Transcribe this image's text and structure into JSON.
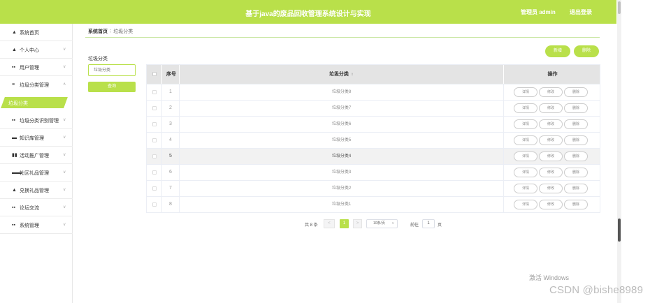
{
  "header": {
    "title": "基于java的废品回收管理系统设计与实现",
    "admin": "管理员 admin",
    "logout": "退出登录"
  },
  "sidebar": {
    "items": [
      {
        "icon": "▲",
        "label": "系统首页",
        "chevron": ""
      },
      {
        "icon": "▲",
        "label": "个人中心",
        "chevron": "∨"
      },
      {
        "icon": "▪▪",
        "label": "用户管理",
        "chevron": "∨"
      },
      {
        "icon": "≡",
        "label": "垃圾分类管理",
        "chevron": "∧"
      },
      {
        "icon": "▪▪",
        "label": "垃圾分类识别管理",
        "chevron": "∨"
      },
      {
        "icon": "▬",
        "label": "知识库管理",
        "chevron": "∨"
      },
      {
        "icon": "▮▮",
        "label": "活动推广管理",
        "chevron": "∨"
      },
      {
        "icon": "▬▬",
        "label": "社区礼品管理",
        "chevron": "∨"
      },
      {
        "icon": "▲",
        "label": "兑换礼品管理",
        "chevron": "∨"
      },
      {
        "icon": "▪▪",
        "label": "论坛交流",
        "chevron": "∨"
      },
      {
        "icon": "▪▪",
        "label": "系统管理",
        "chevron": "∨"
      }
    ],
    "active_sub": "垃圾分类"
  },
  "breadcrumb": {
    "home": "系统首页",
    "sep": "⁝",
    "current": "垃圾分类"
  },
  "filter": {
    "label": "垃圾分类",
    "placeholder": "垃圾分类",
    "query_button": "查询"
  },
  "actions": {
    "add": "新增",
    "delete": "删除"
  },
  "table": {
    "headers": {
      "no": "序号",
      "name": "垃圾分类",
      "sort": "⇕",
      "ops": "操作"
    },
    "rows": [
      {
        "no": "1",
        "name": "垃圾分类8"
      },
      {
        "no": "2",
        "name": "垃圾分类7"
      },
      {
        "no": "3",
        "name": "垃圾分类6"
      },
      {
        "no": "4",
        "name": "垃圾分类5"
      },
      {
        "no": "5",
        "name": "垃圾分类4"
      },
      {
        "no": "6",
        "name": "垃圾分类3"
      },
      {
        "no": "7",
        "name": "垃圾分类2"
      },
      {
        "no": "8",
        "name": "垃圾分类1"
      }
    ],
    "highlight_row": 5,
    "row_ops": {
      "detail": "详情",
      "edit": "修改",
      "delete": "删除"
    }
  },
  "pagination": {
    "total": "共 8 条",
    "prev": "<",
    "current_page": "1",
    "next": ">",
    "page_size": "10条/页",
    "page_size_arrow": "∨",
    "goto_label": "前往",
    "goto_value": "1",
    "page_suffix": "页"
  },
  "watermarks": {
    "windows": "激活 Windows",
    "csdn": "CSDN @bishe8989"
  },
  "colors": {
    "accent": "#b9e04a"
  }
}
